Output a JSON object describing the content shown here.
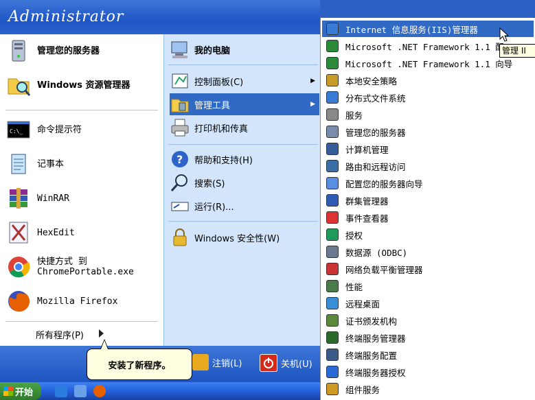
{
  "user": {
    "name": "Administrator"
  },
  "left_pinned": [
    {
      "label": "管理您的服务器",
      "icon": "server-manager-icon",
      "bold": true
    },
    {
      "label": "Windows 资源管理器",
      "icon": "explorer-icon",
      "bold": true
    }
  ],
  "left_recent": [
    {
      "label": "命令提示符",
      "icon": "cmd-icon"
    },
    {
      "label": "记事本",
      "icon": "notepad-icon"
    },
    {
      "label": "WinRAR",
      "icon": "winrar-icon"
    },
    {
      "label": "HexEdit",
      "icon": "hexedit-icon"
    },
    {
      "label": "快捷方式 到\nChromePortable.exe",
      "icon": "chrome-icon"
    },
    {
      "label": "Mozilla Firefox",
      "icon": "firefox-icon"
    }
  ],
  "all_programs": "所有程序(P)",
  "right_items": [
    {
      "label": "我的电脑",
      "icon": "my-computer-icon",
      "bold": true
    },
    {
      "label": "控制面板(C)",
      "icon": "control-panel-icon",
      "arrow": true
    },
    {
      "label": "管理工具",
      "icon": "admin-tools-icon",
      "arrow": true,
      "selected": true
    },
    {
      "label": "打印机和传真",
      "icon": "printer-icon"
    },
    {
      "label": "帮助和支持(H)",
      "icon": "help-icon"
    },
    {
      "label": "搜索(S)",
      "icon": "search-icon"
    },
    {
      "label": "运行(R)...",
      "icon": "run-icon"
    },
    {
      "label": "Windows 安全性(W)",
      "icon": "security-icon"
    }
  ],
  "footer": {
    "logoff": "注销(L)",
    "shutdown": "关机(U)"
  },
  "balloon": "安装了新程序。",
  "taskbar": {
    "start": "开始"
  },
  "admin_tools": [
    {
      "label": "Internet 信息服务(IIS)管理器",
      "icon": "iis-icon",
      "selected": true
    },
    {
      "label": "Microsoft .NET Framework 1.1 配",
      "icon": "dotnet-config-icon"
    },
    {
      "label": "Microsoft .NET Framework 1.1 向导",
      "icon": "dotnet-wizard-icon"
    },
    {
      "label": "本地安全策略",
      "icon": "local-security-icon"
    },
    {
      "label": "分布式文件系统",
      "icon": "dfs-icon"
    },
    {
      "label": "服务",
      "icon": "services-icon"
    },
    {
      "label": "管理您的服务器",
      "icon": "manage-server-icon"
    },
    {
      "label": "计算机管理",
      "icon": "computer-management-icon"
    },
    {
      "label": "路由和远程访问",
      "icon": "routing-icon"
    },
    {
      "label": "配置您的服务器向导",
      "icon": "configure-server-icon"
    },
    {
      "label": "群集管理器",
      "icon": "cluster-icon"
    },
    {
      "label": "事件查看器",
      "icon": "event-viewer-icon"
    },
    {
      "label": "授权",
      "icon": "licensing-icon"
    },
    {
      "label": "数据源 (ODBC)",
      "icon": "odbc-icon"
    },
    {
      "label": "网络负载平衡管理器",
      "icon": "nlb-icon"
    },
    {
      "label": "性能",
      "icon": "performance-icon"
    },
    {
      "label": "远程桌面",
      "icon": "remote-desktop-icon"
    },
    {
      "label": "证书颁发机构",
      "icon": "certificate-icon"
    },
    {
      "label": "终端服务管理器",
      "icon": "ts-manager-icon"
    },
    {
      "label": "终端服务配置",
      "icon": "ts-config-icon"
    },
    {
      "label": "终端服务器授权",
      "icon": "ts-licensing-icon"
    },
    {
      "label": "组件服务",
      "icon": "component-services-icon"
    }
  ],
  "tooltip": "管理 II",
  "colors": {
    "selection": "#316ac5",
    "header": "#2a62cf",
    "right_pane": "#d3e5fa",
    "start_green": "#3c8f38"
  }
}
